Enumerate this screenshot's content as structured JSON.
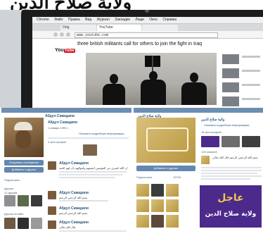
{
  "photo": {
    "headline": "ولاية صلاح الدين",
    "menubar": [
      "Chrome",
      "Файл",
      "Правка",
      "Вид",
      "Журнал",
      "Закладки",
      "Люди",
      "Окно",
      "Справка"
    ],
    "tabs": [
      "Orig",
      "YouTube",
      "",
      ""
    ],
    "url": "www.youtube.com",
    "yt_logo_you": "You",
    "yt_logo_tube": "Tube",
    "video_title": "three british militants call for others to join the fight in Iraq"
  },
  "vk_left": {
    "page_name": "Абдул Самадапи",
    "profile_name": "Абдул Самадапи",
    "send_message": "Отправить сообщение",
    "add_friend": "Добавить в друзья",
    "subscribers_label": "Подписчики",
    "friends_label": "Друзья",
    "photos_label": "4 фотографии",
    "show_more": "Показать подробную информацию",
    "birthday": "1 января 1990 г.",
    "posts": [
      {
        "author": "Абдул Самадапи",
        "text": "ان الله اشترى من المؤمنين أنفسهم وأموالهم بأن لهم الجنة"
      },
      {
        "author": "Абдул Самадапи",
        "text": "بسم الله الرحمن الرحيم"
      },
      {
        "author": "Абдул Самадапи",
        "text": "بسم الله الرحمن الرحيم"
      },
      {
        "author": "Абдул Самадапи",
        "text": "قال الله تعالى"
      }
    ],
    "friends_count_label": "12 друзей",
    "online_label": "Друзья онлайн"
  },
  "vk_right": {
    "page_name": "ولاية صلاح الدين",
    "group_name": "ولاية صلاح الدين",
    "join_button": "Добавить в друзья",
    "followers_label": "Подписчики",
    "followers_count": "13716",
    "photos_label": "18 фотографий",
    "video_label": "139 записей",
    "post_text": "بسم الله الرحمن الرحيم قال الله تعالى",
    "show_more": "Показать подробную информацию",
    "banner_line1": "عاجل",
    "banner_line2": "ولاية صلاح الدين"
  }
}
